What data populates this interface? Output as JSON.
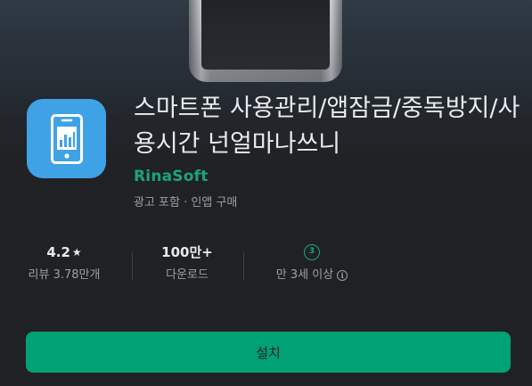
{
  "app": {
    "title": "스마트폰 사용관리/앱잠금/중독방지/사용시간 넌얼마나쓰니",
    "developer": "RinaSoft",
    "monetization": "광고 포함 · 인앱 구매",
    "icon": "phone-chart-icon",
    "icon_color": "#3fa2e7"
  },
  "stats": {
    "rating": {
      "value": "4.2",
      "star": "★",
      "label": "리뷰 3.78만개"
    },
    "downloads": {
      "value": "100만+",
      "label": "다운로드"
    },
    "content_rating": {
      "badge": "3",
      "label": "만 3세 이상",
      "info_icon": "info-icon"
    }
  },
  "actions": {
    "install_label": "설치",
    "install_color": "#00a173"
  },
  "colors": {
    "background": "#202124",
    "accent": "#1aa67a"
  }
}
